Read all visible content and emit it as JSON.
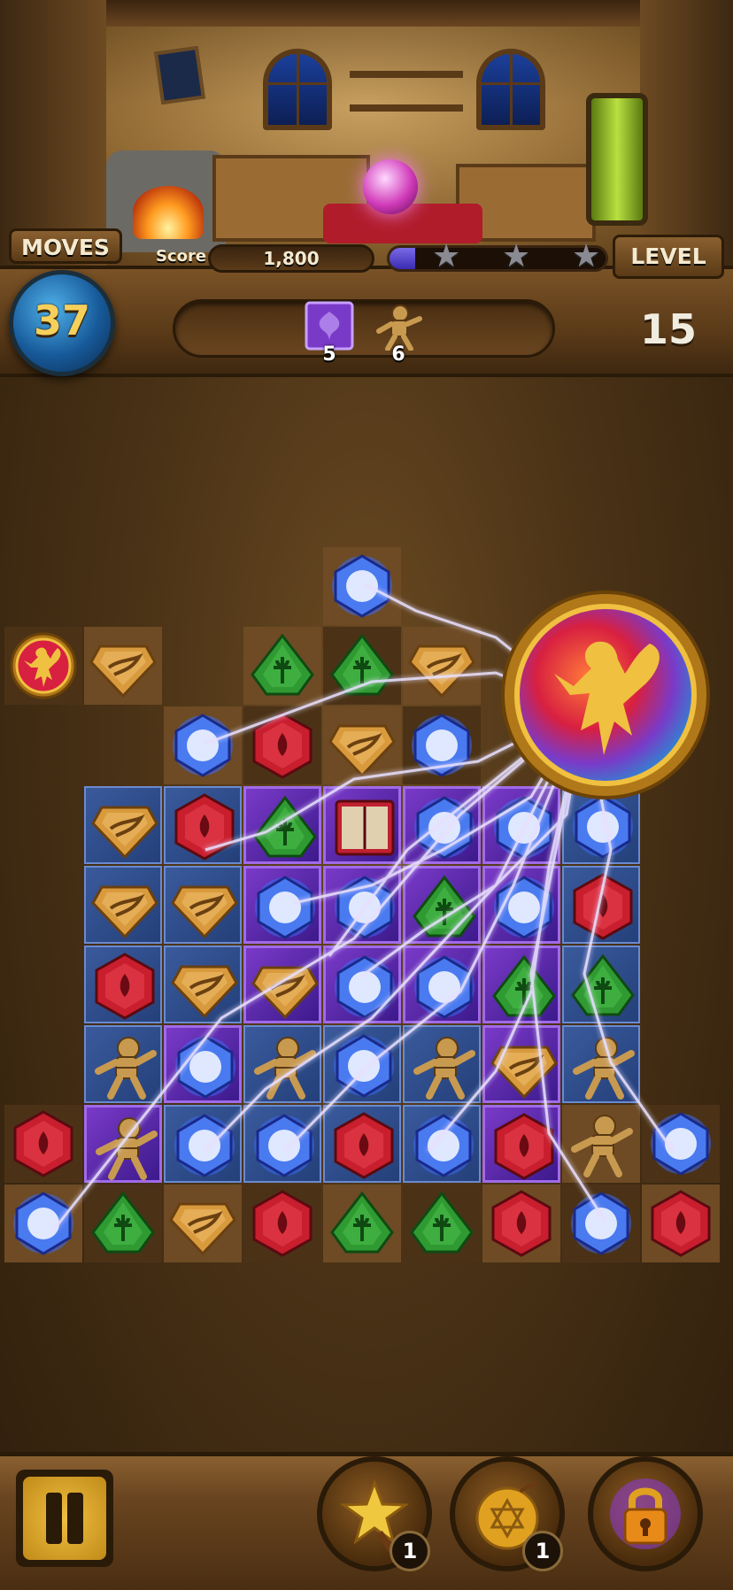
{
  "hud": {
    "moves_label": "MOVES",
    "moves_value": "37",
    "score_label": "Score",
    "score_value": "1,800",
    "score_progress": 0.12,
    "stars_earned": 0,
    "stars_total": 3,
    "level_label": "LEVEL",
    "level_value": "15"
  },
  "goals": [
    {
      "icon": "fairy-tile-icon",
      "count": "5"
    },
    {
      "icon": "voodoo-doll-icon",
      "count": "6"
    }
  ],
  "board": {
    "rows": [
      [
        null,
        null,
        null,
        null,
        "blue-gem",
        null,
        null,
        null,
        null
      ],
      [
        "fairy-medallion",
        "amber-gem",
        null,
        "green-gem",
        "green-gem",
        "amber-gem",
        null,
        null,
        null
      ],
      [
        null,
        null,
        "blue-gem",
        "red-gem",
        "amber-gem",
        "blue-gem",
        null,
        null,
        null
      ],
      [
        null,
        "amber-gem",
        "red-gem",
        "green-gem",
        "spellbook",
        "blue-gem",
        "blue-gem",
        "blue-gem",
        null
      ],
      [
        null,
        "amber-gem",
        "amber-gem",
        "blue-gem",
        "blue-gem",
        "green-gem",
        "blue-gem",
        "red-gem",
        null
      ],
      [
        null,
        "red-gem",
        "amber-gem",
        "amber-gem",
        "blue-gem",
        "blue-gem",
        "green-gem",
        "green-gem",
        null
      ],
      [
        null,
        "voodoo-doll",
        "blue-gem",
        "voodoo-doll",
        "blue-gem",
        "voodoo-doll",
        "amber-gem",
        "voodoo-doll",
        null
      ],
      [
        "red-gem",
        "voodoo-doll",
        "blue-gem",
        "blue-gem",
        "red-gem",
        "blue-gem",
        "red-gem",
        "voodoo-doll",
        "blue-gem"
      ],
      [
        "blue-gem",
        "green-gem",
        "amber-gem",
        "red-gem",
        "green-gem",
        "green-gem",
        "red-gem",
        "blue-gem",
        "red-gem"
      ]
    ]
  },
  "boosters": [
    {
      "name": "star-wand-booster",
      "count": "1"
    },
    {
      "name": "bomb-booster",
      "count": "1"
    },
    {
      "name": "locked-booster",
      "count": ""
    }
  ],
  "colors": {
    "red": "#c81e2e",
    "green": "#2f9a32",
    "amber": "#d89a3c",
    "blue": "#3a6af0",
    "progress": "#4a3ac8",
    "medallion_gold": "#e0a828"
  }
}
